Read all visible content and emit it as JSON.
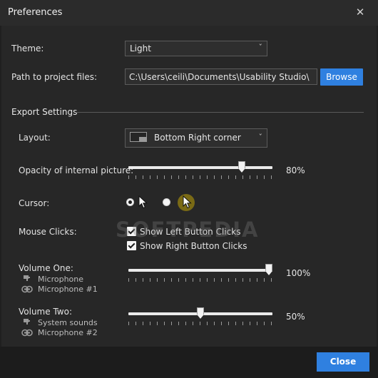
{
  "window": {
    "title": "Preferences",
    "close_glyph": "✕"
  },
  "theme": {
    "label": "Theme:",
    "value": "Light",
    "chevron": "ˇ"
  },
  "path": {
    "label": "Path to project files:",
    "value": "C:\\Users\\ceili\\Documents\\Usability Studio\\",
    "browse_label": "Browse"
  },
  "export": {
    "section_title": "Export Settings",
    "layout": {
      "label": "Layout:",
      "value": "Bottom Right corner",
      "chevron": "ˇ"
    },
    "opacity": {
      "label": "Opacity of internal picture:",
      "value": 80,
      "value_text": "80%"
    },
    "cursor": {
      "label": "Cursor:",
      "options": [
        "standard-arrow",
        "highlighted-arrow"
      ],
      "selected": 0
    },
    "mouse_clicks": {
      "label": "Mouse Clicks:",
      "left": {
        "label": "Show Left Button Clicks",
        "checked": true
      },
      "right": {
        "label": "Show Right Button Clicks",
        "checked": true
      }
    },
    "volume_one": {
      "label": "Volume One:",
      "sources": [
        {
          "icon": "speaker-icon",
          "label": "Microphone"
        },
        {
          "icon": "microphone-icon",
          "label": "Microphone #1"
        }
      ],
      "value": 100,
      "value_text": "100%"
    },
    "volume_two": {
      "label": "Volume Two:",
      "sources": [
        {
          "icon": "speaker-icon",
          "label": "System sounds"
        },
        {
          "icon": "microphone-icon",
          "label": "Microphone #2"
        }
      ],
      "value": 50,
      "value_text": "50%"
    }
  },
  "footer": {
    "close_label": "Close"
  },
  "watermark": "SOFTPEDIA",
  "colors": {
    "accent": "#2f80e0",
    "cursor_highlight": "#7a6a15",
    "background": "#272727"
  }
}
